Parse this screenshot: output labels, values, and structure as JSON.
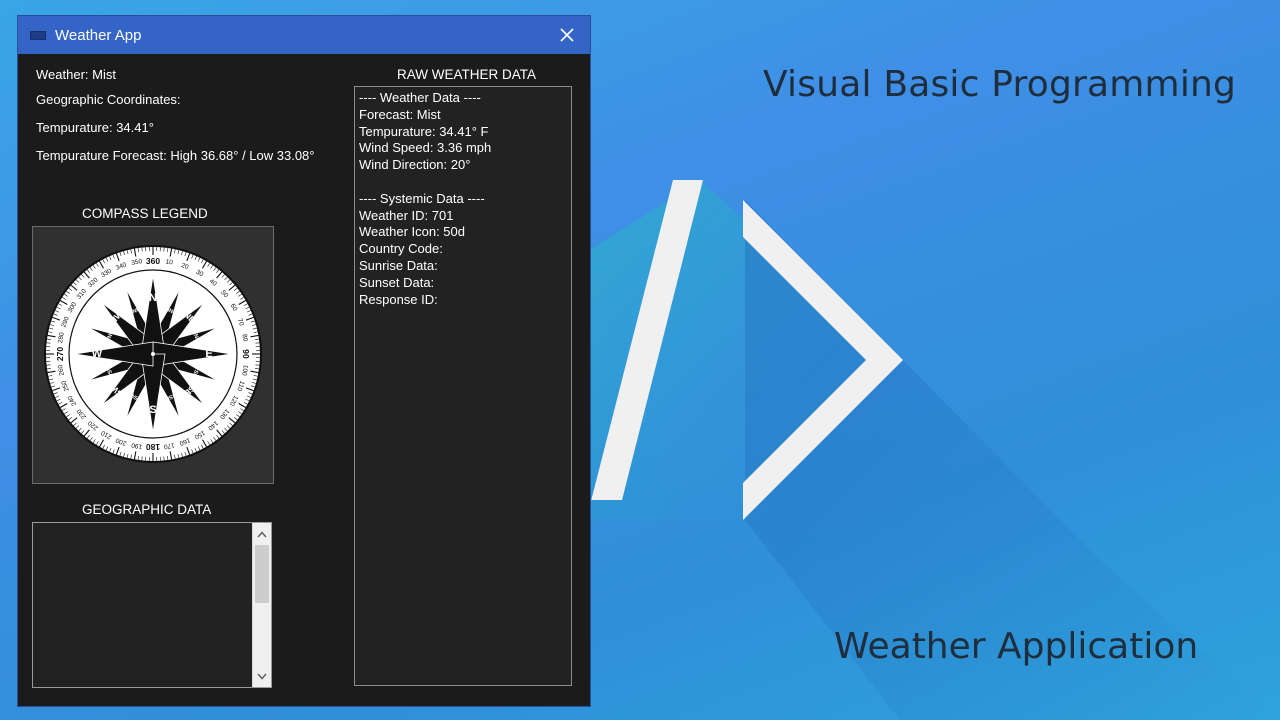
{
  "slide": {
    "title": "Visual Basic Programming",
    "subtitle": "Weather Application"
  },
  "window": {
    "title": "Weather App",
    "close_glyph": "✕"
  },
  "info": {
    "weather": "Weather: Mist",
    "coordinates": "Geographic Coordinates:",
    "temperature": "Tempurature: 34.41°",
    "forecast": "Tempurature Forecast: High 36.68° / Low 33.08°"
  },
  "compass": {
    "label": "COMPASS LEGEND",
    "cardinals": [
      "N",
      "E",
      "S",
      "W"
    ],
    "intercardinals": [
      "NE",
      "SE",
      "SW",
      "NW"
    ],
    "minor": [
      "NNE",
      "ENE",
      "ESE",
      "SSE",
      "SSW",
      "WSW",
      "WNW",
      "NNW"
    ],
    "degrees": [
      "360",
      "10",
      "20",
      "30",
      "40",
      "50",
      "60",
      "70",
      "80",
      "90",
      "100",
      "110",
      "120",
      "130",
      "140",
      "150",
      "160",
      "170",
      "180",
      "190",
      "200",
      "210",
      "220",
      "230",
      "240",
      "250",
      "260",
      "270",
      "280",
      "290",
      "300",
      "310",
      "320",
      "330",
      "340",
      "350"
    ]
  },
  "geographic": {
    "label": "GEOGRAPHIC DATA",
    "up_arrow": "˄",
    "down_arrow": "˅"
  },
  "raw": {
    "label": "RAW WEATHER DATA",
    "lines": [
      "---- Weather Data ----",
      "Forecast: Mist",
      "Tempurature: 34.41° F",
      "Wind Speed: 3.36 mph",
      "Wind Direction: 20°",
      "",
      "---- Systemic Data ----",
      "Weather ID: 701",
      "Weather Icon: 50d",
      "Country Code:",
      "Sunrise Data:",
      "Sunset Data:",
      "Response ID:"
    ]
  },
  "colors": {
    "titlebar": "#3465c6",
    "window_bg": "#1b1b1b",
    "panel_bg": "#222222",
    "chevron": "#f0f0f0"
  }
}
